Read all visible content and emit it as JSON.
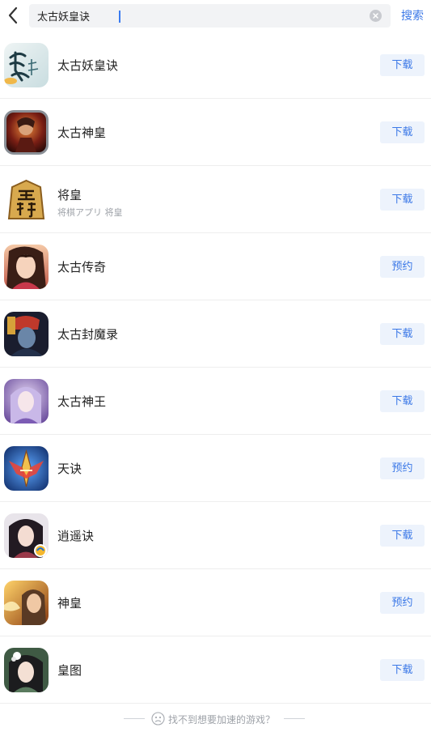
{
  "search": {
    "value": "太古妖皇诀",
    "button_label": "搜索"
  },
  "results": [
    {
      "name": "太古妖皇诀",
      "subtitle": "",
      "action": "下载",
      "icon": "game-icon-taigu-yaohuang"
    },
    {
      "name": "太古神皇",
      "subtitle": "",
      "action": "下载",
      "icon": "game-icon-taigu-shenhuang"
    },
    {
      "name": "将皇",
      "subtitle": "将棋アプリ 将皇",
      "action": "下载",
      "icon": "game-icon-shogi"
    },
    {
      "name": "太古传奇",
      "subtitle": "",
      "action": "预约",
      "icon": "game-icon-taigu-chuanqi"
    },
    {
      "name": "太古封魔录",
      "subtitle": "",
      "action": "下载",
      "icon": "game-icon-taigu-fengmo"
    },
    {
      "name": "太古神王",
      "subtitle": "",
      "action": "下载",
      "icon": "game-icon-taigu-shenwang"
    },
    {
      "name": "天诀",
      "subtitle": "",
      "action": "预约",
      "icon": "game-icon-tianjue"
    },
    {
      "name": "逍遥诀",
      "subtitle": "",
      "action": "下载",
      "icon": "game-icon-xiaoyao"
    },
    {
      "name": "神皇",
      "subtitle": "",
      "action": "预约",
      "icon": "game-icon-shenhuang"
    },
    {
      "name": "皇图",
      "subtitle": "",
      "action": "下载",
      "icon": "game-icon-huangtu"
    }
  ],
  "footer": {
    "text": "找不到想要加速的游戏？"
  },
  "colors": {
    "accent": "#3b78e7",
    "button_bg": "#edf3fc",
    "search_bg": "#f2f3f5"
  }
}
